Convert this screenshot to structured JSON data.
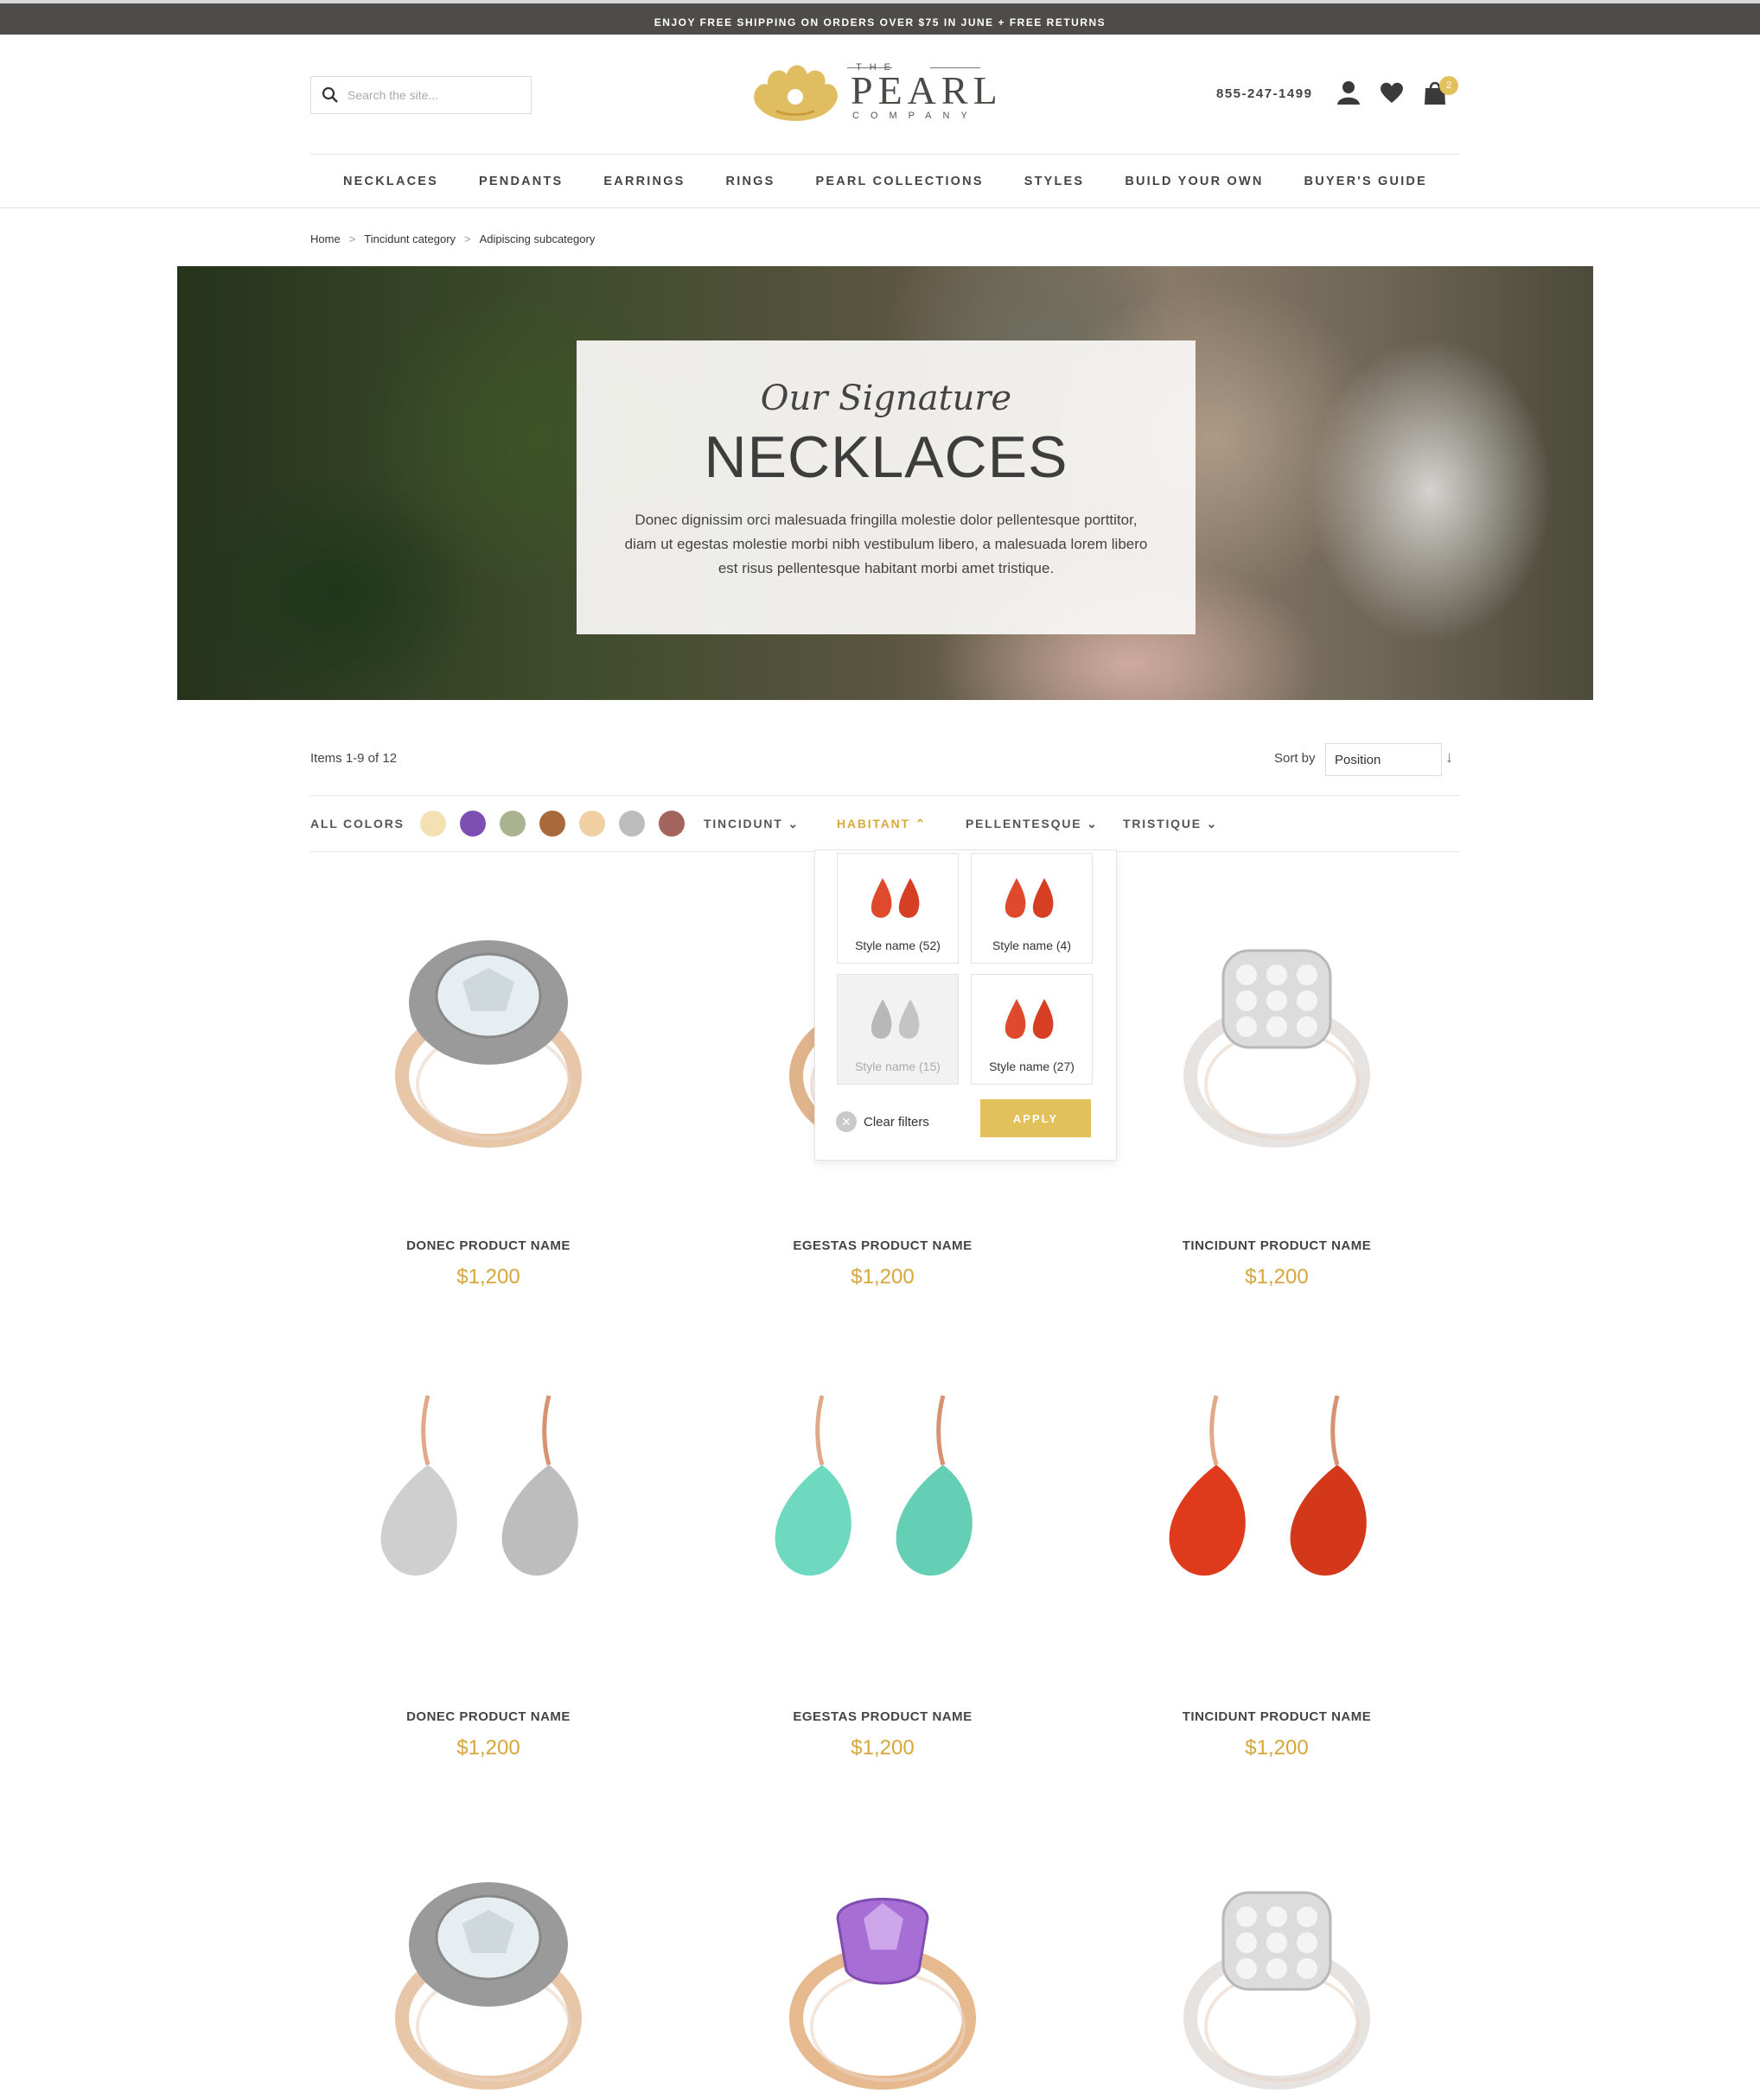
{
  "promo": "ENJOY FREE SHIPPING ON ORDERS OVER $75 IN JUNE + FREE RETURNS",
  "search": {
    "placeholder": "Search the site..."
  },
  "logo": {
    "the": "THE",
    "name": "PEARL",
    "company": "COMPANY"
  },
  "header": {
    "phone": "855-247-1499",
    "cart_count": "2"
  },
  "nav": [
    "NECKLACES",
    "PENDANTS",
    "EARRINGS",
    "RINGS",
    "PEARL COLLECTIONS",
    "STYLES",
    "BUILD YOUR OWN",
    "BUYER'S GUIDE"
  ],
  "breadcrumb": [
    "Home",
    "Tincidunt category",
    "Adipiscing subcategory"
  ],
  "breadcrumb_sep": ">",
  "hero": {
    "script": "Our Signature",
    "title": "NECKLACES",
    "text": "Donec dignissim orci malesuada fringilla molestie dolor pellentesque porttitor, diam ut egestas molestie morbi nibh vestibulum libero, a malesuada lorem libero est risus pellentesque habitant morbi amet tristique."
  },
  "toolbar": {
    "items": "Items 1-9 of 12",
    "sort_label": "Sort by",
    "sort_value": "Position"
  },
  "filters": {
    "all_colors": "ALL COLORS",
    "swatches": [
      "#f3e1b4",
      "#7d4fb3",
      "#a9b48f",
      "#a86a3a",
      "#f0cfa3",
      "#bdbdbd",
      "#a3645e"
    ],
    "dropdowns": [
      "TINCIDUNT",
      "HABITANT",
      "PELLENTESQUE",
      "TRISTIQUE"
    ],
    "active": "HABITANT"
  },
  "dropdown": {
    "tiles": [
      {
        "label": "Style name (52)",
        "color": "red"
      },
      {
        "label": "Style name (4)",
        "color": "red"
      },
      {
        "label": "Style name (15)",
        "color": "silver"
      },
      {
        "label": "Style name (27)",
        "color": "red"
      }
    ],
    "clear": "Clear filters",
    "apply": "APPLY"
  },
  "products": [
    {
      "name": "DONEC PRODUCT NAME",
      "price": "$1,200",
      "image": "diamond-ring"
    },
    {
      "name": "EGESTAS PRODUCT NAME",
      "price": "$1,200",
      "image": "gold-ring"
    },
    {
      "name": "TINCIDUNT PRODUCT NAME",
      "price": "$1,200",
      "image": "pave-ring"
    },
    {
      "name": "DONEC PRODUCT NAME",
      "price": "$1,200",
      "image": "clear-earrings"
    },
    {
      "name": "EGESTAS PRODUCT NAME",
      "price": "$1,200",
      "image": "mint-earrings"
    },
    {
      "name": "TINCIDUNT PRODUCT NAME",
      "price": "$1,200",
      "image": "red-earrings"
    },
    {
      "name": "",
      "price": "",
      "image": "diamond-ring"
    },
    {
      "name": "",
      "price": "",
      "image": "amethyst-ring"
    },
    {
      "name": "",
      "price": "",
      "image": "pave-ring"
    }
  ],
  "colors": {
    "gold": "#d6a63a",
    "accent": "#e2c15c",
    "promo_bg": "#4e4c49"
  }
}
